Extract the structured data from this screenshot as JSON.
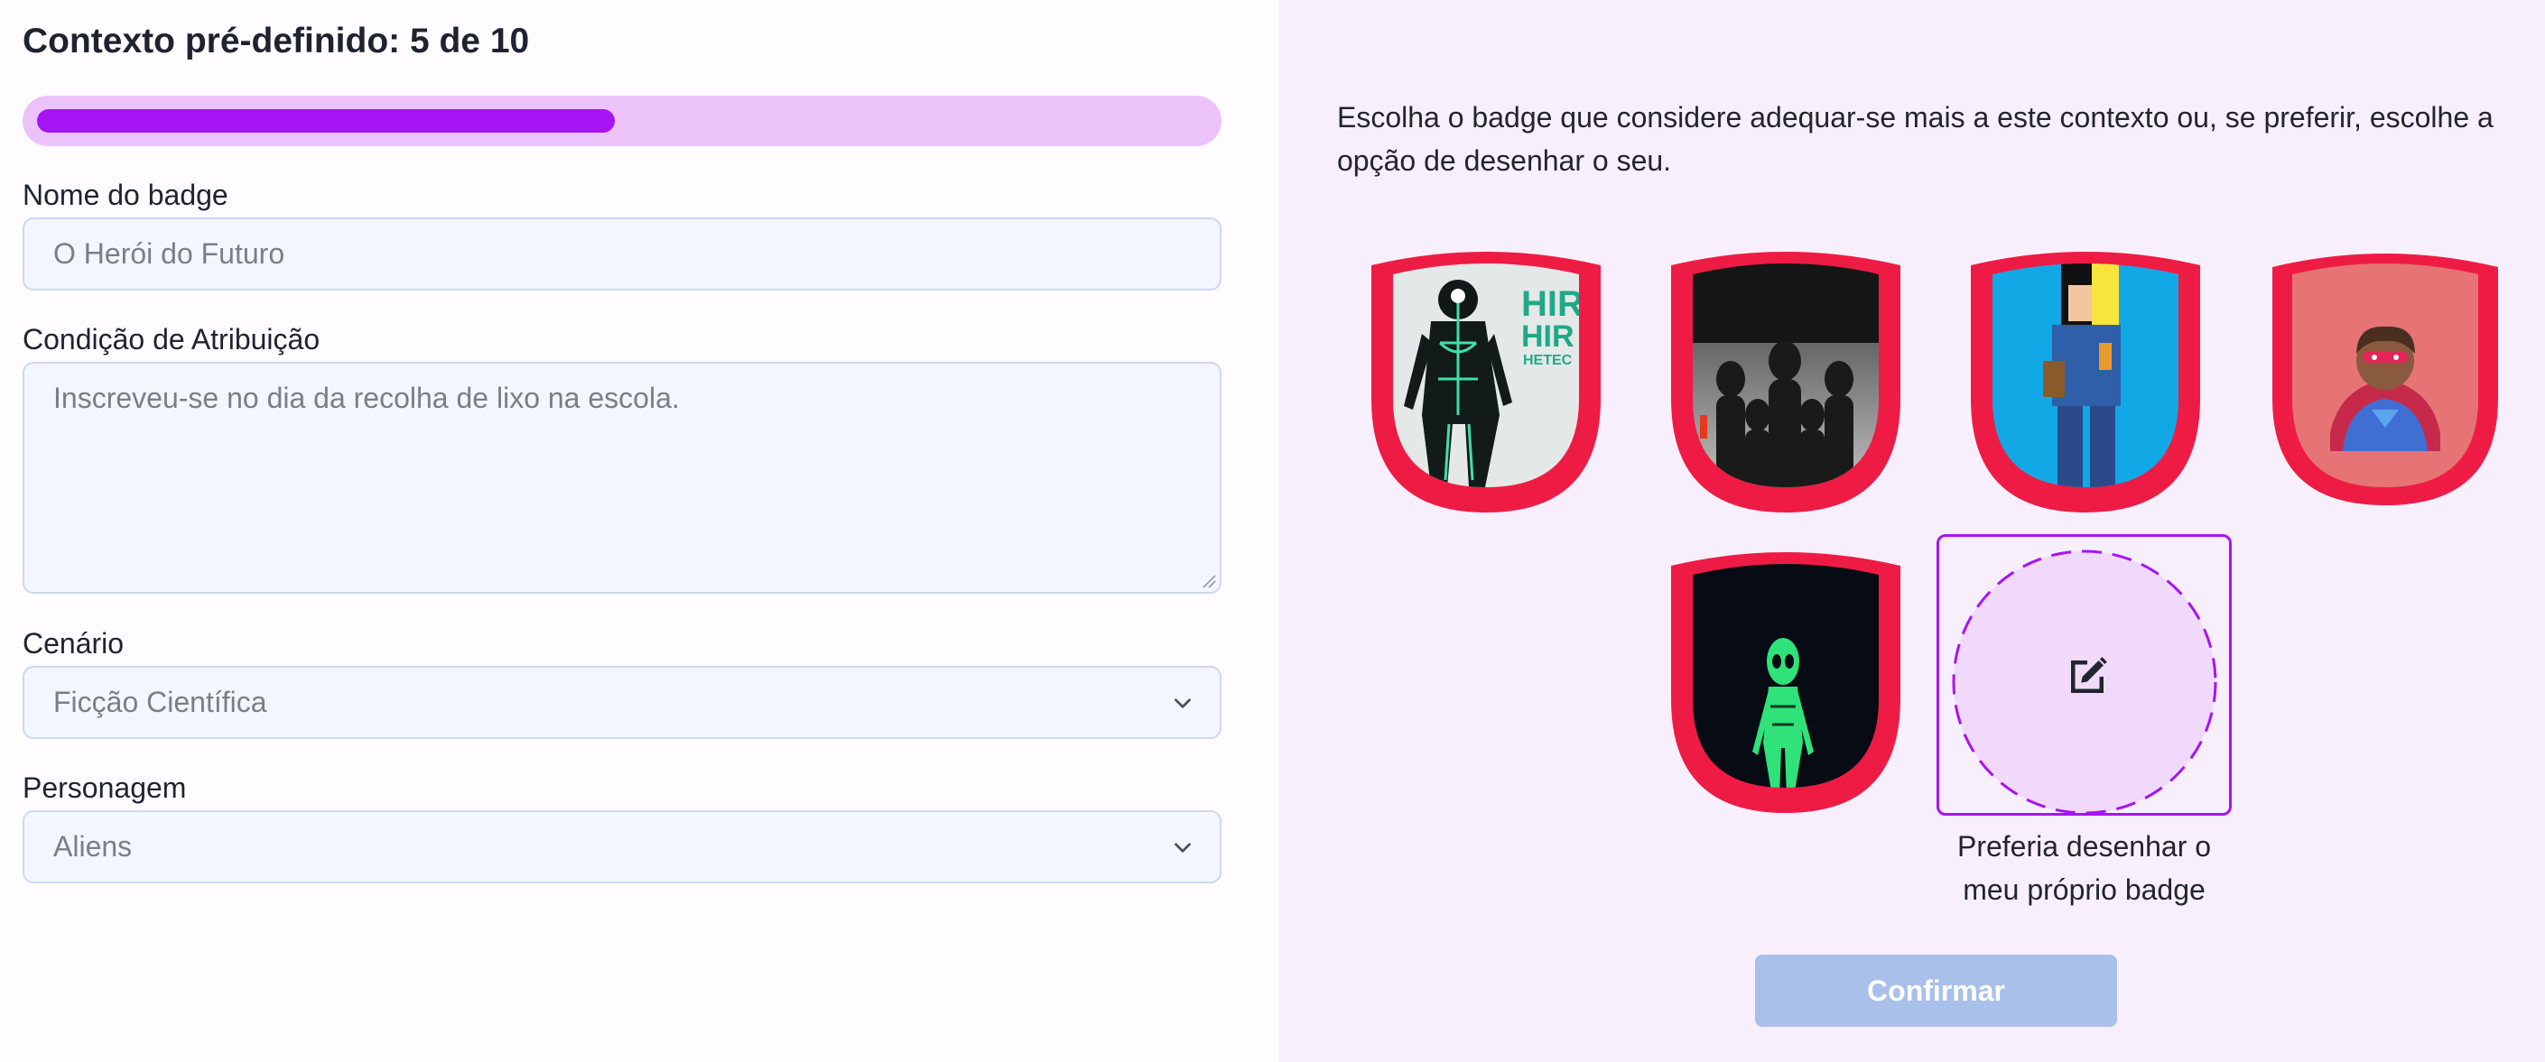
{
  "header": {
    "title": "Contexto pré-definido: 5 de 10",
    "progress_fraction": 0.5
  },
  "form": {
    "badge_name": {
      "label": "Nome do badge",
      "value": "O Herói do Futuro"
    },
    "condition": {
      "label": "Condição de Atribuição",
      "value": "Inscreveu-se no dia da recolha de lixo na escola."
    },
    "scenario": {
      "label": "Cenário",
      "selected": "Ficção Científica"
    },
    "character": {
      "label": "Personagem",
      "selected": "Aliens"
    }
  },
  "chooser": {
    "instructions": "Escolha o badge que considere adequar-se mais a este contexto ou, se preferir, escolhe a opção de desenhar o seu.",
    "badges": [
      {
        "icon": "green-circuit-robot-icon"
      },
      {
        "icon": "shadow-crowd-icon"
      },
      {
        "icon": "pixel-character-icon"
      },
      {
        "icon": "caped-hero-emoji-icon"
      },
      {
        "icon": "green-alien-icon"
      }
    ],
    "draw_option": {
      "icon": "pencil-edit-icon",
      "caption_line1": "Preferia desenhar o",
      "caption_line2": "meu próprio badge"
    },
    "confirm_label": "Confirmar"
  },
  "colors": {
    "accent": "#a614f3",
    "progress_track": "#ecc2fb",
    "badge_border": "#ee1c44",
    "panel_bg": "#f8effd",
    "confirm_disabled": "#a8c0ea"
  }
}
